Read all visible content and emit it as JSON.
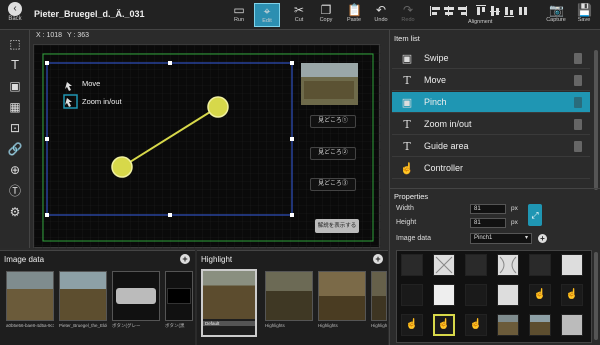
{
  "toolbar": {
    "back_label": "Back",
    "title": "Pieter_Bruegel_d._Ä._031",
    "buttons": {
      "run": "Run",
      "edit": "Edit",
      "cut": "Cut",
      "copy": "Copy",
      "paste": "Paste",
      "undo": "Undo",
      "redo": "Redo",
      "alignment": "Alignment",
      "capture": "Capture",
      "save": "Save"
    }
  },
  "canvas": {
    "coord_x": "X : 1018",
    "coord_y": "Y : 363",
    "legend_move": "Move",
    "legend_zoom": "Zoom in/out",
    "spot1": "見どころ①",
    "spot2": "見どころ②",
    "spot3": "見どころ③",
    "explain": "解説を表示する"
  },
  "image_data": {
    "title": "Image data",
    "thumbs": [
      {
        "caption": "a0b5e56-bae8-4d5a-9c74"
      },
      {
        "caption": "Pieter_Bruegel_the_Elder"
      },
      {
        "caption": "ボタン(グレー"
      },
      {
        "caption": "ボタン(黒"
      }
    ]
  },
  "highlight": {
    "title": "Highlight",
    "thumbs": [
      {
        "caption": "Default"
      },
      {
        "caption": "Highlights"
      },
      {
        "caption": "Highlights"
      },
      {
        "caption": "Highlights"
      }
    ]
  },
  "item_list": {
    "title": "Item list",
    "items": [
      {
        "label": "Swipe",
        "icon": "image-icon"
      },
      {
        "label": "Move",
        "icon": "text-icon"
      },
      {
        "label": "Pinch",
        "icon": "image-icon"
      },
      {
        "label": "Zoom in/out",
        "icon": "text-icon"
      },
      {
        "label": "Guide area",
        "icon": "text-icon"
      },
      {
        "label": "Controller",
        "icon": "controller-icon"
      }
    ]
  },
  "properties": {
    "title": "Properties",
    "width_label": "Width",
    "width_value": "81",
    "height_label": "Height",
    "height_value": "81",
    "unit": "px",
    "image_data_label": "Image data",
    "image_data_value": "Pinch1"
  },
  "colors": {
    "accent": "#1f96b3",
    "highlight_line": "#d7d84a",
    "selection": "#2f4fbf"
  }
}
